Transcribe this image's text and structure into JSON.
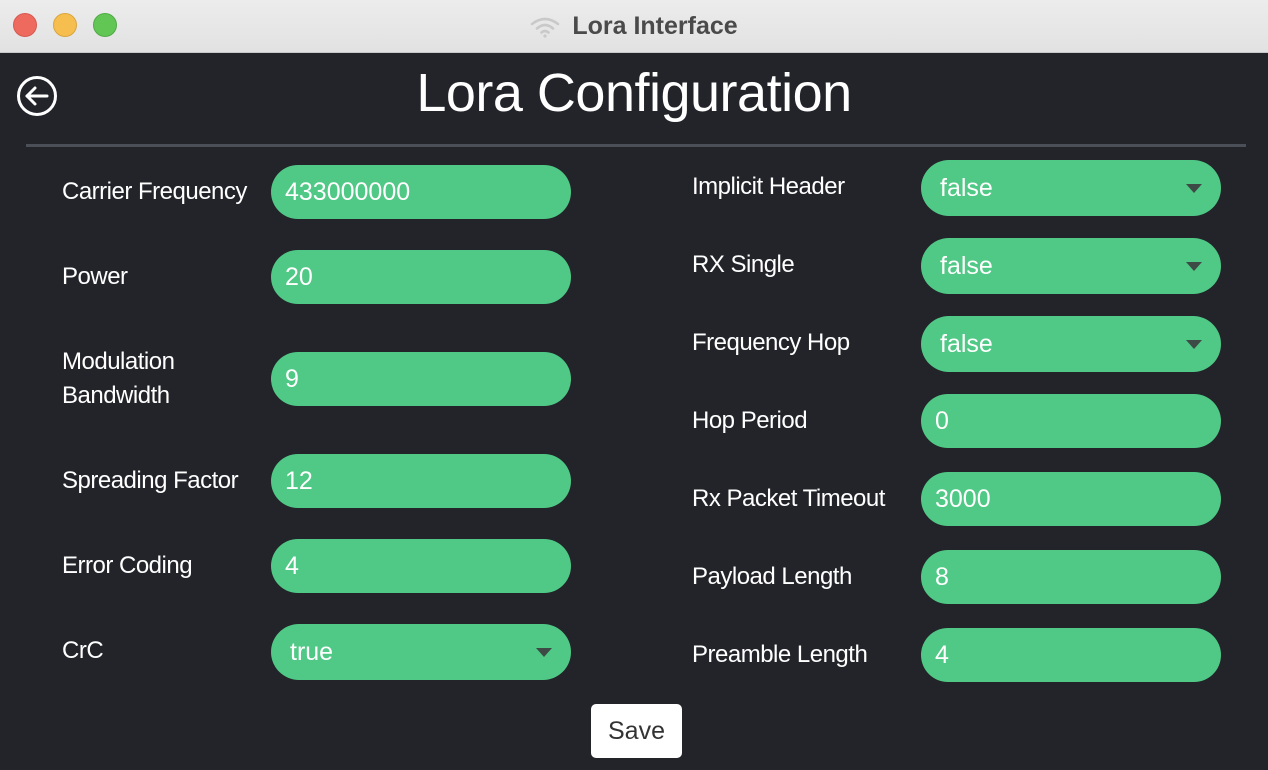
{
  "window": {
    "title": "Lora Interface"
  },
  "header": {
    "title": "Lora Configuration"
  },
  "left": {
    "carrier_frequency": {
      "label": "Carrier Frequency",
      "value": "433000000"
    },
    "power": {
      "label": "Power",
      "value": "20"
    },
    "modulation_bandwidth": {
      "label_line1": "Modulation",
      "label_line2": "Bandwidth",
      "value": "9"
    },
    "spreading_factor": {
      "label": "Spreading Factor",
      "value": "12"
    },
    "error_coding": {
      "label": "Error Coding",
      "value": "4"
    },
    "crc": {
      "label": "CrC",
      "value": "true"
    }
  },
  "right": {
    "implicit_header": {
      "label": "Implicit Header",
      "value": "false"
    },
    "rx_single": {
      "label": "RX Single",
      "value": "false"
    },
    "frequency_hop": {
      "label": "Frequency Hop",
      "value": "false"
    },
    "hop_period": {
      "label": "Hop Period",
      "value": "0"
    },
    "rx_packet_timeout": {
      "label": "Rx Packet Timeout",
      "value": "3000"
    },
    "payload_length": {
      "label": "Payload Length",
      "value": "8"
    },
    "preamble_length": {
      "label": "Preamble Length",
      "value": "4"
    }
  },
  "actions": {
    "save_label": "Save"
  },
  "icons": {
    "back": "back-arrow-circle-icon",
    "title": "wifi-icon",
    "dropdown": "chevron-down-icon"
  },
  "colors": {
    "background": "#22242a",
    "field": "#4fc985",
    "titlebar": "#e6e6e6"
  }
}
